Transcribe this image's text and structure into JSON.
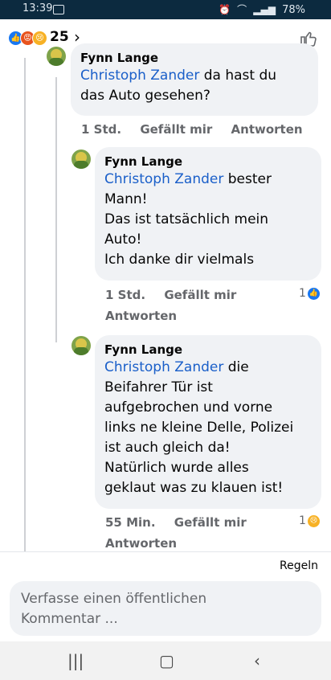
{
  "status": {
    "time": "13:39",
    "battery": "78%"
  },
  "header": {
    "reaction_count": "25"
  },
  "comments": [
    {
      "author": "Fynn Lange",
      "mention": "Christoph Zander",
      "text_lines": [
        "da hast du",
        "das Auto gesehen?"
      ],
      "time": "1 Std.",
      "like": "Gefällt mir",
      "reply": "Antworten"
    },
    {
      "author": "Fynn Lange",
      "mention": "Christoph Zander",
      "text_lines": [
        "bester",
        "Mann!",
        "Das ist tatsächlich mein",
        "Auto!",
        "Ich danke dir vielmals"
      ],
      "time": "1 Std.",
      "like": "Gefällt mir",
      "reply": "Antworten",
      "reaction_count": "1"
    },
    {
      "author": "Fynn Lange",
      "mention": "Christoph Zander",
      "text_lines": [
        "die",
        "Beifahrer Tür ist",
        "aufgebrochen und vorne",
        "links ne kleine Delle, Polizei",
        "ist auch gleich da!",
        "Natürlich wurde alles",
        "geklaut was zu klauen ist!"
      ],
      "time": "55 Min.",
      "like": "Gefällt mir",
      "reply": "Antworten",
      "reaction_count": "1"
    }
  ],
  "footer": {
    "rules_label": "Regeln",
    "composer_placeholder_line1": "Verfasse einen öffentlichen",
    "composer_placeholder_line2": "Kommentar ..."
  },
  "icons": {
    "like_color": "#1877f2",
    "angry_color": "#e8531e",
    "sad_color": "#f7b125"
  }
}
